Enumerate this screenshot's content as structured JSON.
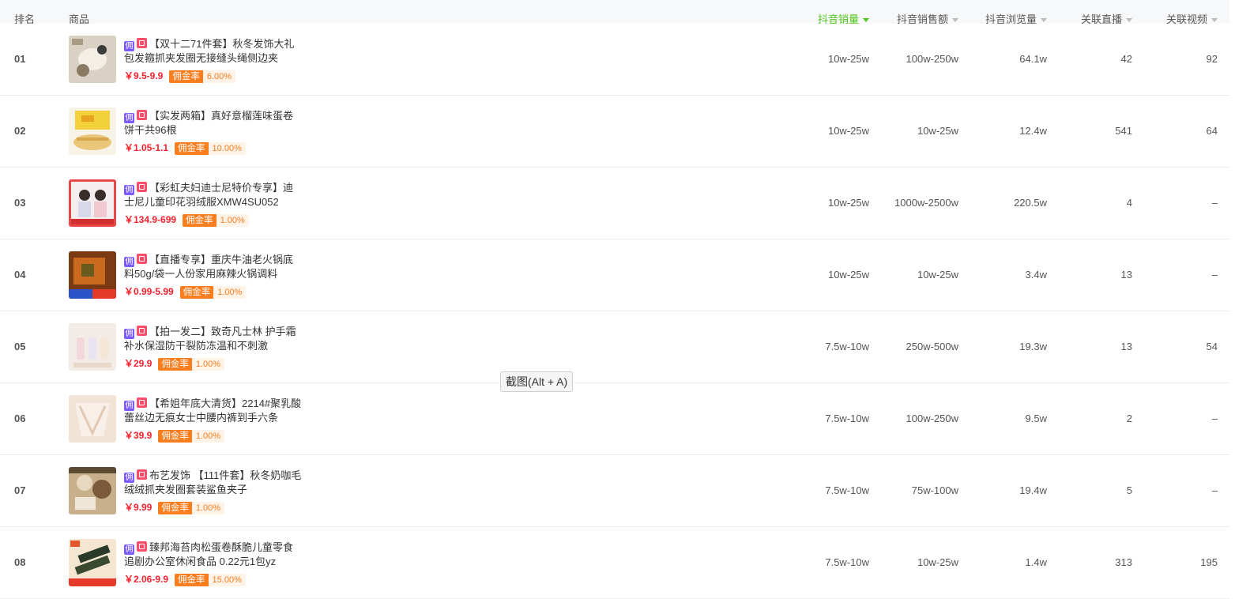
{
  "header": {
    "rank": "排名",
    "product": "商品",
    "cols": [
      "抖音销量",
      "抖音销售额",
      "抖音浏览量",
      "关联直播",
      "关联视频"
    ],
    "active_col": "抖音销量",
    "accent": "#52c41a"
  },
  "tags": {
    "commission": "佣",
    "douyin": "douyin-shop-icon"
  },
  "rate_label": "佣金率",
  "rows": [
    {
      "rank": "01",
      "title": "【双十二71件套】秋冬发饰大礼包发箍抓夹发圈无接缝头绳侧边夹",
      "price": "￥9.5-9.9",
      "rate": "6.00%",
      "sales": "10w-25w",
      "revenue": "100w-250w",
      "views": "64.1w",
      "live": "42",
      "video": "92"
    },
    {
      "rank": "02",
      "title": "【实发两箱】真好意榴莲味蛋卷饼干共96根",
      "price": "￥1.05-1.1",
      "rate": "10.00%",
      "sales": "10w-25w",
      "revenue": "10w-25w",
      "views": "12.4w",
      "live": "541",
      "video": "64"
    },
    {
      "rank": "03",
      "title": "【彩虹夫妇迪士尼特价专享】迪士尼儿童印花羽绒服XMW4SU052",
      "price": "￥134.9-699",
      "rate": "1.00%",
      "sales": "10w-25w",
      "revenue": "1000w-2500w",
      "views": "220.5w",
      "live": "4",
      "video": "–"
    },
    {
      "rank": "04",
      "title": "【直播专享】重庆牛油老火锅底料50g/袋一人份家用麻辣火锅调料",
      "price": "￥0.99-5.99",
      "rate": "1.00%",
      "sales": "10w-25w",
      "revenue": "10w-25w",
      "views": "3.4w",
      "live": "13",
      "video": "–"
    },
    {
      "rank": "05",
      "title": "【拍一发二】致奇凡士林 护手霜补水保湿防干裂防冻温和不刺激",
      "price": "￥29.9",
      "rate": "1.00%",
      "sales": "7.5w-10w",
      "revenue": "250w-500w",
      "views": "19.3w",
      "live": "13",
      "video": "54"
    },
    {
      "rank": "06",
      "title": "【希姐年底大清货】2214#聚乳酸蕾丝边无痕女士中腰内裤到手六条",
      "price": "￥39.9",
      "rate": "1.00%",
      "sales": "7.5w-10w",
      "revenue": "100w-250w",
      "views": "9.5w",
      "live": "2",
      "video": "–"
    },
    {
      "rank": "07",
      "title": "布艺发饰 【111件套】秋冬奶咖毛绒绒抓夹发圈套装鲨鱼夹子",
      "price": "￥9.99",
      "rate": "1.00%",
      "sales": "7.5w-10w",
      "revenue": "75w-100w",
      "views": "19.4w",
      "live": "5",
      "video": "–"
    },
    {
      "rank": "08",
      "title": "臻邦海苔肉松蛋卷酥脆儿童零食追剧办公室休闲食品 0.22元1包yz",
      "price": "￥2.06-9.9",
      "rate": "15.00%",
      "sales": "7.5w-10w",
      "revenue": "10w-25w",
      "views": "1.4w",
      "live": "313",
      "video": "195"
    }
  ],
  "tooltip": "截图(Alt + A)"
}
